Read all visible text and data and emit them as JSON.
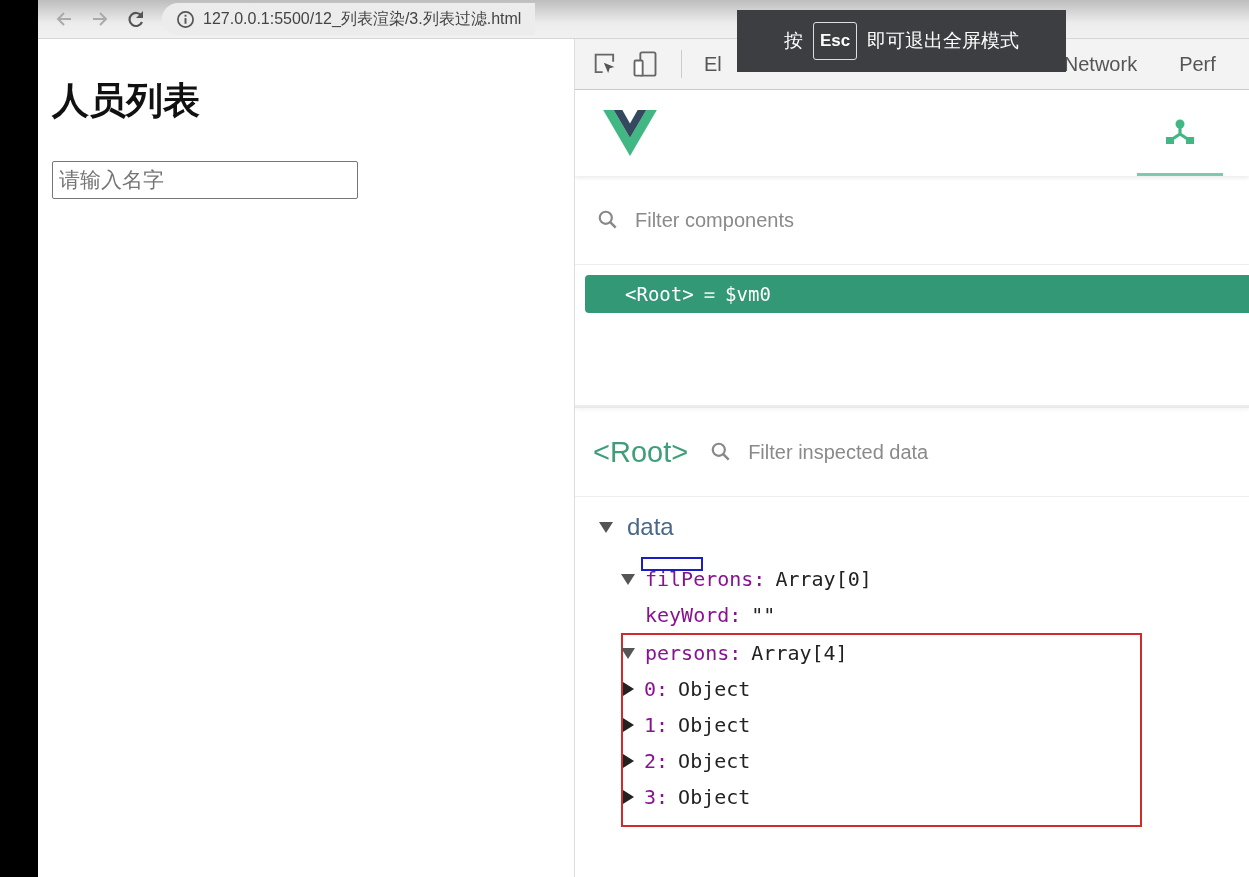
{
  "browser": {
    "url": "127.0.0.1:5500/12_列表渲染/3.列表过滤.html"
  },
  "page": {
    "heading": "人员列表",
    "search": {
      "placeholder": "请输入名字"
    }
  },
  "devtools": {
    "tabs": [
      {
        "label": "El"
      },
      {
        "label": "Network"
      },
      {
        "label": "Perf"
      }
    ]
  },
  "vue": {
    "tabs": [
      {
        "kind": "components",
        "selected": true
      }
    ],
    "component_filter": {
      "placeholder": "Filter components"
    },
    "component_tree": [
      {
        "name": "<Root>",
        "equals": "=",
        "ref": "$vm0",
        "selected": true
      }
    ],
    "inspector": {
      "component": "<Root>",
      "placeholder": "Filter inspected data",
      "section": {
        "label": "data",
        "expanded": true,
        "children": [
          {
            "key": "filPerons:",
            "value": "Array[0]",
            "expanded": true,
            "marked": true
          },
          {
            "key": "keyWord:",
            "value": "\"\""
          },
          {
            "key": "persons:",
            "value": "Array[4]",
            "expanded": true,
            "outlined": true,
            "children": [
              {
                "key": "0:",
                "value": "Object",
                "expanded": false
              },
              {
                "key": "1:",
                "value": "Object",
                "expanded": false
              },
              {
                "key": "2:",
                "value": "Object",
                "expanded": false
              },
              {
                "key": "3:",
                "value": "Object",
                "expanded": false
              }
            ]
          }
        ]
      }
    }
  },
  "fullscreen_notice": {
    "before": "按",
    "key": "Esc",
    "after": "即可退出全屏模式"
  }
}
